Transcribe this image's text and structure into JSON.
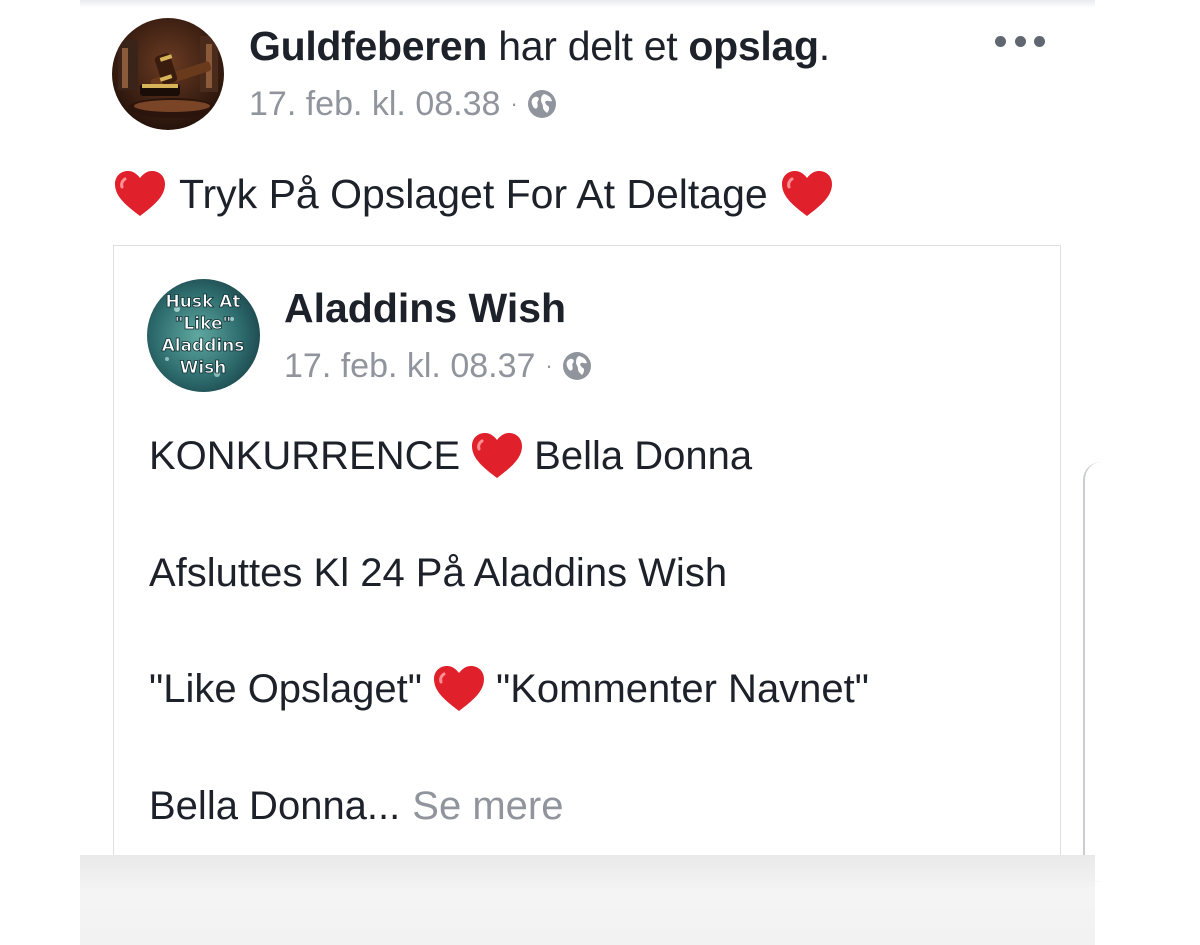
{
  "post": {
    "author": "Guldfeberen",
    "action_text": " har delt et ",
    "object_text": "opslag",
    "period": ".",
    "timestamp": "17. feb. kl. 08.38",
    "separator": "·",
    "body_text": "Tryk På Opslaget For At Deltage"
  },
  "shared_post": {
    "avatar_text": [
      "Husk At",
      "\"Like\"",
      "Aladdins",
      "Wish"
    ],
    "author": "Aladdins Wish",
    "timestamp": "17. feb. kl. 08.37",
    "separator": "·",
    "line1_a": "KONKURRENCE",
    "line1_b": "Bella Donna",
    "line2": "Afsluttes Kl 24 På Aladdins Wish",
    "line3_a": "\"Like Opslaget\"",
    "line3_b": "\"Kommenter Navnet\"",
    "line4": "Bella Donna...",
    "see_more": "Se mere"
  },
  "icons": {
    "globe": "globe-icon",
    "more": "more-options-icon",
    "heart": "red-heart-icon"
  },
  "colors": {
    "text": "#1d2129",
    "meta": "#90949c",
    "heart": "#e0202b",
    "border": "#dddfe2"
  }
}
